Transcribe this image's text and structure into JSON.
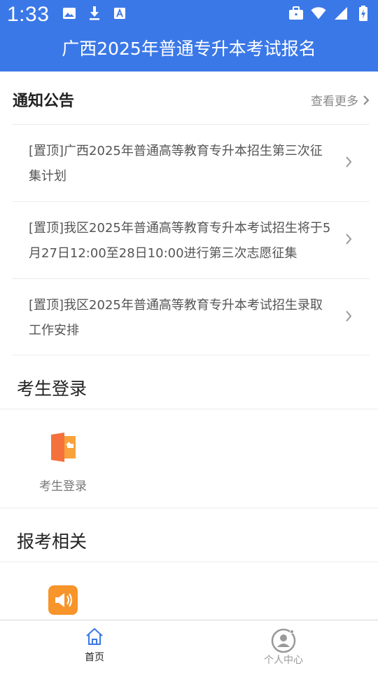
{
  "status_bar": {
    "time": "1:33"
  },
  "header": {
    "title": "广西2025年普通专升本考试报名"
  },
  "notices": {
    "title": "通知公告",
    "more_label": "查看更多",
    "items": [
      {
        "text": "[置顶]广西2025年普通高等教育专升本招生第三次征集计划"
      },
      {
        "text": "[置顶]我区2025年普通高等教育专升本考试招生将于5月27日12:00至28日10:00进行第三次志愿征集"
      },
      {
        "text": "[置顶]我区2025年普通高等教育专升本考试招生录取工作安排"
      }
    ]
  },
  "login_section": {
    "title": "考生登录",
    "tile_label": "考生登录",
    "icon_color": "#f5713b"
  },
  "exam_section": {
    "title": "报考相关",
    "icon_color": "#f7942a"
  },
  "tab_bar": {
    "active_color": "#3b78e7",
    "inactive_color": "#999999",
    "tabs": [
      {
        "label": "首页",
        "icon": "home-icon",
        "active": true
      },
      {
        "label": "个人中心",
        "icon": "user-center-icon",
        "active": false
      }
    ]
  }
}
